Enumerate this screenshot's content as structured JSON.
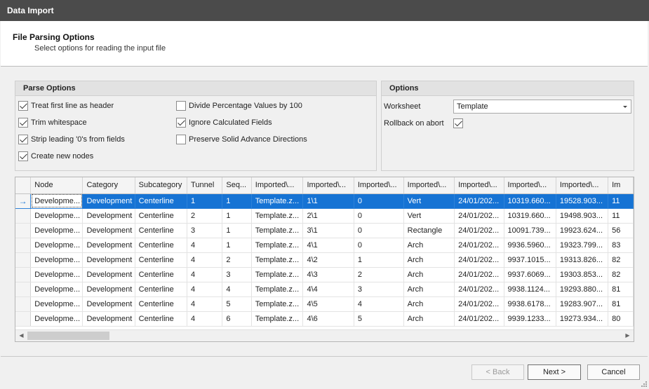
{
  "window": {
    "title": "Data Import"
  },
  "header": {
    "title": "File Parsing Options",
    "subtitle": "Select options for reading the input file"
  },
  "parse_options": {
    "title": "Parse Options",
    "items": [
      {
        "label": "Treat first line as header",
        "checked": true
      },
      {
        "label": "Trim whitespace",
        "checked": true
      },
      {
        "label": "Strip leading '0's from fields",
        "checked": true
      },
      {
        "label": "Create new nodes",
        "checked": true
      },
      {
        "label": "Divide Percentage Values by 100",
        "checked": false
      },
      {
        "label": "Ignore Calculated Fields",
        "checked": true
      },
      {
        "label": "Preserve Solid Advance Directions",
        "checked": false
      }
    ]
  },
  "options": {
    "title": "Options",
    "worksheet_label": "Worksheet",
    "worksheet_value": "Template",
    "rollback_label": "Rollback on abort",
    "rollback_checked": true
  },
  "grid": {
    "selected_indicator": "→",
    "columns": [
      "Node",
      "Category",
      "Subcategory",
      "Tunnel",
      "Seq...",
      "Imported\\...",
      "Imported\\...",
      "Imported\\...",
      "Imported\\...",
      "Imported\\...",
      "Imported\\...",
      "Imported\\...",
      "Im"
    ],
    "rows": [
      [
        "Developme...",
        "Development",
        "Centerline",
        "1",
        "1",
        "Template.z...",
        "1\\1",
        "0",
        "Vert",
        "24/01/202...",
        "10319.660...",
        "19528.903...",
        "11"
      ],
      [
        "Developme...",
        "Development",
        "Centerline",
        "2",
        "1",
        "Template.z...",
        "2\\1",
        "0",
        "Vert",
        "24/01/202...",
        "10319.660...",
        "19498.903...",
        "11"
      ],
      [
        "Developme...",
        "Development",
        "Centerline",
        "3",
        "1",
        "Template.z...",
        "3\\1",
        "0",
        "Rectangle",
        "24/01/202...",
        "10091.739...",
        "19923.624...",
        "56"
      ],
      [
        "Developme...",
        "Development",
        "Centerline",
        "4",
        "1",
        "Template.z...",
        "4\\1",
        "0",
        "Arch",
        "24/01/202...",
        "9936.5960...",
        "19323.799...",
        "83"
      ],
      [
        "Developme...",
        "Development",
        "Centerline",
        "4",
        "2",
        "Template.z...",
        "4\\2",
        "1",
        "Arch",
        "24/01/202...",
        "9937.1015...",
        "19313.826...",
        "82"
      ],
      [
        "Developme...",
        "Development",
        "Centerline",
        "4",
        "3",
        "Template.z...",
        "4\\3",
        "2",
        "Arch",
        "24/01/202...",
        "9937.6069...",
        "19303.853...",
        "82"
      ],
      [
        "Developme...",
        "Development",
        "Centerline",
        "4",
        "4",
        "Template.z...",
        "4\\4",
        "3",
        "Arch",
        "24/01/202...",
        "9938.1124...",
        "19293.880...",
        "81"
      ],
      [
        "Developme...",
        "Development",
        "Centerline",
        "4",
        "5",
        "Template.z...",
        "4\\5",
        "4",
        "Arch",
        "24/01/202...",
        "9938.6178...",
        "19283.907...",
        "81"
      ],
      [
        "Developme...",
        "Development",
        "Centerline",
        "4",
        "6",
        "Template.z...",
        "4\\6",
        "5",
        "Arch",
        "24/01/202...",
        "9939.1233...",
        "19273.934...",
        "80"
      ]
    ]
  },
  "buttons": {
    "back": "< Back",
    "next": "Next >",
    "cancel": "Cancel"
  },
  "colors": {
    "titlebar": "#4b4b4b",
    "selection": "#1673d4"
  }
}
